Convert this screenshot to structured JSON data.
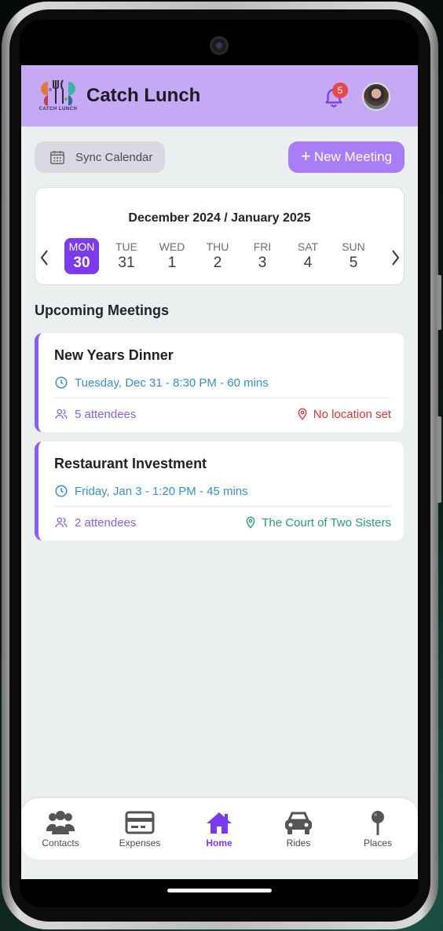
{
  "header": {
    "logo_text": "CATCH LUNCH",
    "title": "Catch Lunch",
    "notification_count": "5",
    "colors": {
      "header_bg": "#c5a9f5",
      "accent": "#7c3aed",
      "badge": "#e5484d"
    }
  },
  "actions": {
    "sync_label": "Sync Calendar",
    "new_meeting_plus": "+",
    "new_meeting_label": "New Meeting"
  },
  "calendar": {
    "title": "December 2024 / January 2025",
    "prev_icon": "chevron-left-icon",
    "next_icon": "chevron-right-icon",
    "days": [
      {
        "name": "MON",
        "date": "30",
        "selected": true
      },
      {
        "name": "TUE",
        "date": "31",
        "selected": false
      },
      {
        "name": "WED",
        "date": "1",
        "selected": false
      },
      {
        "name": "THU",
        "date": "2",
        "selected": false
      },
      {
        "name": "FRI",
        "date": "3",
        "selected": false
      },
      {
        "name": "SAT",
        "date": "4",
        "selected": false
      },
      {
        "name": "SUN",
        "date": "5",
        "selected": false
      }
    ]
  },
  "upcoming": {
    "title": "Upcoming Meetings",
    "meetings": [
      {
        "title": "New Years Dinner",
        "time": "Tuesday, Dec 31 - 8:30 PM - 60 mins",
        "attendees": "5 attendees",
        "location": "No location set",
        "location_color": "#d0393e"
      },
      {
        "title": "Restaurant Investment",
        "time": "Friday, Jan 3 - 1:20 PM - 45 mins",
        "attendees": "2 attendees",
        "location": "The Court of Two Sisters",
        "location_color": "#2e9a6b"
      }
    ]
  },
  "nav": {
    "items": [
      {
        "label": "Contacts",
        "icon": "contacts-icon",
        "active": false
      },
      {
        "label": "Expenses",
        "icon": "credit-card-icon",
        "active": false
      },
      {
        "label": "Home",
        "icon": "home-icon",
        "active": true
      },
      {
        "label": "Rides",
        "icon": "car-icon",
        "active": false
      },
      {
        "label": "Places",
        "icon": "map-pin-icon",
        "active": false
      }
    ]
  }
}
